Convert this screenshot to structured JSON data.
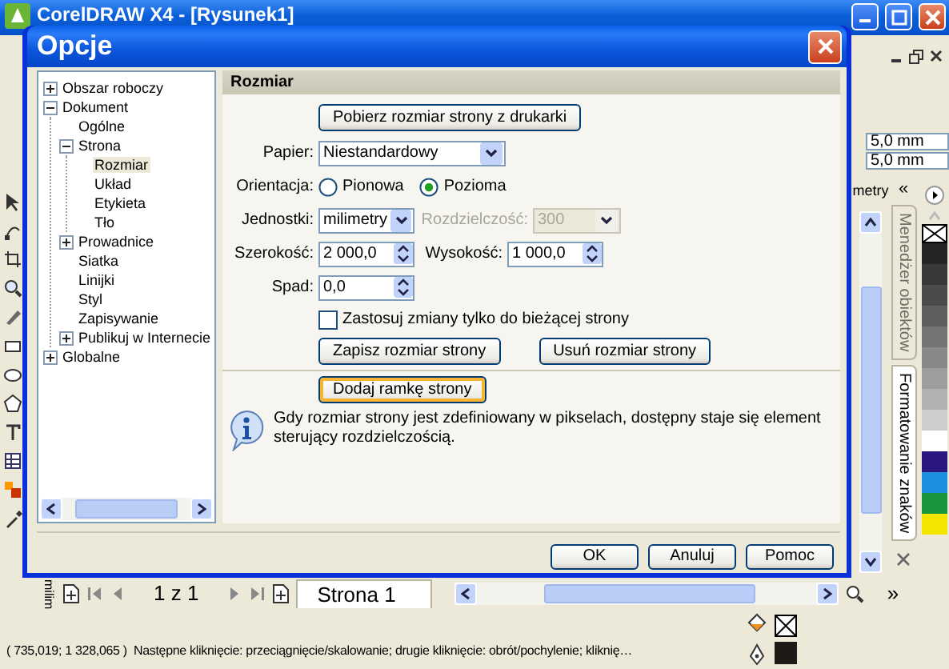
{
  "app": {
    "title": "CorelDRAW X4 - [Rysunek1]"
  },
  "property_bar": {
    "x_value": "5,0 mm",
    "y_value": "5,0 mm"
  },
  "ruler_unit": "metry",
  "docker_collapse": "«",
  "dockers": [
    {
      "label": "Menedżer obiektów",
      "selected": false
    },
    {
      "label": "Formatowanie znaków",
      "selected": true
    }
  ],
  "palette": [
    {
      "color": "#252525"
    },
    {
      "color": "#383838"
    },
    {
      "color": "#4b4b4b"
    },
    {
      "color": "#5f5f5f"
    },
    {
      "color": "#747474"
    },
    {
      "color": "#888888"
    },
    {
      "color": "#9d9d9d"
    },
    {
      "color": "#b1b1b1"
    },
    {
      "color": "#cdcdcd"
    },
    {
      "color": "#ffffff"
    },
    {
      "color": "#2c1780"
    },
    {
      "color": "#1f8fe0"
    },
    {
      "color": "#17963c"
    },
    {
      "color": "#f2e600"
    }
  ],
  "ruler_label": "milim",
  "page_nav": {
    "counter": "1 z 1",
    "tabs": [
      {
        "label": "Strona 1",
        "selected": true
      }
    ]
  },
  "more_button": "»",
  "status_bar": {
    "coordinates": "( 735,019; 1 328,065 )",
    "message": "Następne kliknięcie: przeciągnięcie/skalowanie; drugie kliknięcie: obrót/pochylenie; kliknię…"
  },
  "dialog": {
    "title": "Opcje",
    "tree": [
      {
        "label": "Obszar roboczy",
        "expanded": false,
        "selected": false
      },
      {
        "label": "Dokument",
        "expanded": true,
        "selected": false,
        "children": [
          {
            "label": "Ogólne",
            "selected": false
          },
          {
            "label": "Strona",
            "expanded": true,
            "selected": false,
            "children": [
              {
                "label": "Rozmiar",
                "selected": true
              },
              {
                "label": "Układ",
                "selected": false
              },
              {
                "label": "Etykieta",
                "selected": false
              },
              {
                "label": "Tło",
                "selected": false
              }
            ]
          },
          {
            "label": "Prowadnice",
            "expanded": false,
            "selected": false
          },
          {
            "label": "Siatka",
            "selected": false
          },
          {
            "label": "Linijki",
            "selected": false
          },
          {
            "label": "Styl",
            "selected": false
          },
          {
            "label": "Zapisywanie",
            "selected": false
          },
          {
            "label": "Publikuj w Internecie",
            "expanded": false,
            "selected": false
          }
        ]
      },
      {
        "label": "Globalne",
        "expanded": false,
        "selected": false
      }
    ],
    "section_title": "Rozmiar",
    "printer_button": "Pobierz rozmiar strony z drukarki",
    "paper": {
      "label": "Papier:",
      "value": "Niestandardowy"
    },
    "orientation": {
      "label": "Orientacja:",
      "options": [
        {
          "label": "Pionowa",
          "selected": false
        },
        {
          "label": "Pozioma",
          "selected": true
        }
      ]
    },
    "units": {
      "label": "Jednostki:",
      "value": "milimetry"
    },
    "resolution": {
      "label": "Rozdzielczość:",
      "value": "300",
      "disabled": true
    },
    "width": {
      "label": "Szerokość:",
      "value": "2 000,0"
    },
    "height": {
      "label": "Wysokość:",
      "value": "1 000,0"
    },
    "bleed": {
      "label": "Spad:",
      "value": "0,0"
    },
    "current_page_only": {
      "label": "Zastosuj zmiany tylko do bieżącej strony",
      "checked": false
    },
    "save_button": "Zapisz rozmiar strony",
    "delete_button": "Usuń rozmiar strony",
    "frame_button": {
      "label": "Dodaj ramkę strony",
      "focused": true
    },
    "info": "Gdy rozmiar strony jest zdefiniowany w pikselach, dostępny staje się element sterujący rozdzielczością.",
    "buttons": [
      "OK",
      "Anuluj",
      "Pomoc"
    ]
  }
}
